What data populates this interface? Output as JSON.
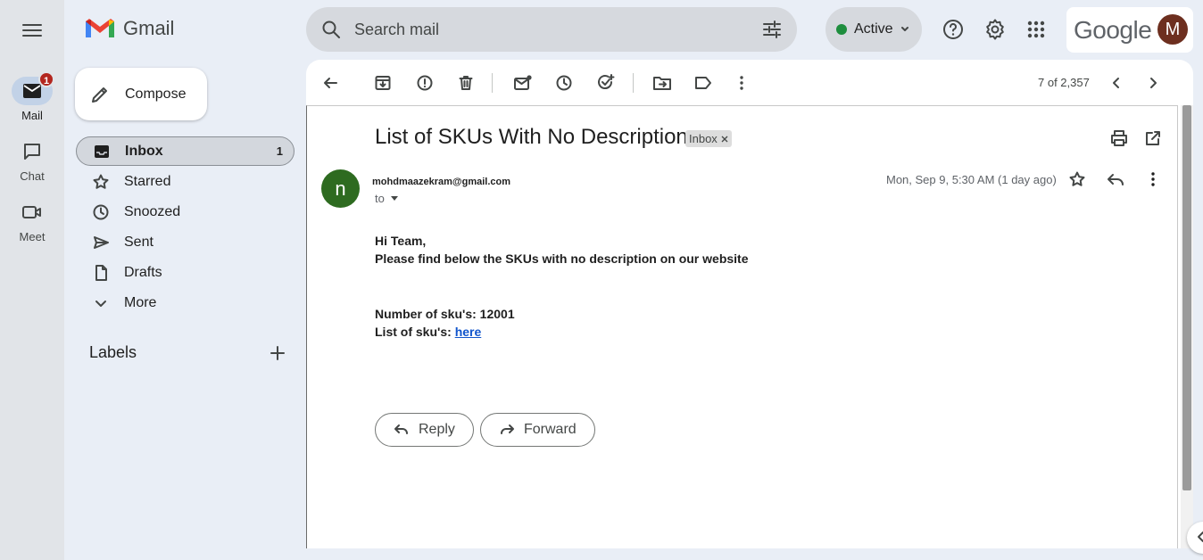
{
  "app": {
    "name": "Gmail"
  },
  "rail": {
    "items": [
      {
        "label": "Mail",
        "badge": "1",
        "icon": "mail-icon"
      },
      {
        "label": "Chat",
        "icon": "chat-icon"
      },
      {
        "label": "Meet",
        "icon": "video-icon"
      }
    ]
  },
  "search": {
    "placeholder": "Search mail"
  },
  "status": {
    "label": "Active",
    "color": "#1e8e3e"
  },
  "account": {
    "brand": "Google",
    "avatar_letter": "M"
  },
  "compose": {
    "label": "Compose"
  },
  "nav": {
    "items": [
      {
        "label": "Inbox",
        "count": "1",
        "icon": "inbox-icon"
      },
      {
        "label": "Starred",
        "icon": "star-icon"
      },
      {
        "label": "Snoozed",
        "icon": "clock-icon"
      },
      {
        "label": "Sent",
        "icon": "send-icon"
      },
      {
        "label": "Drafts",
        "icon": "draft-icon"
      },
      {
        "label": "More",
        "icon": "chevron-down-icon"
      }
    ],
    "labels_heading": "Labels"
  },
  "toolbar": {
    "pager": "7 of 2,357"
  },
  "message": {
    "subject": "List of SKUs With No Description",
    "label_chip": "Inbox",
    "sender_avatar": "n",
    "sender": "mohdmaazekram@gmail.com",
    "to": "to",
    "date": "Mon, Sep 9, 5:30 AM (1 day ago)",
    "body": {
      "greeting": "Hi Team,",
      "intro": "Please find below the SKUs with no description on our website",
      "count_line": "Number of sku's: 12001",
      "list_prefix": "List of sku's: ",
      "list_link": "here"
    },
    "reply_label": "Reply",
    "forward_label": "Forward"
  }
}
